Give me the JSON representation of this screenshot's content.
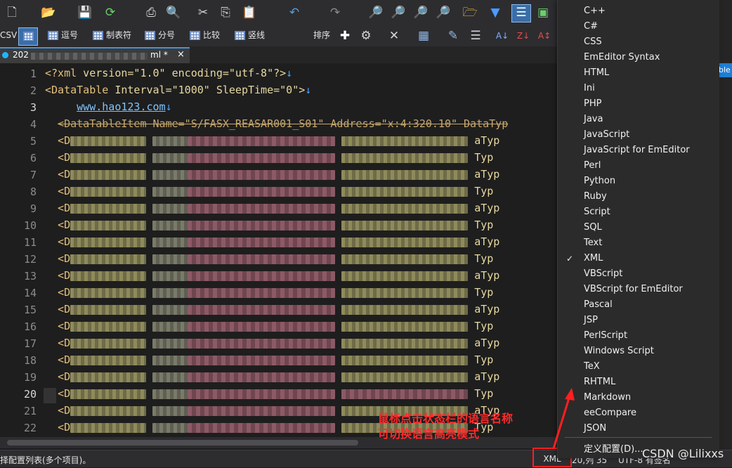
{
  "toolbar2": {
    "csv_label": "CSV",
    "buttons": [
      "逗号",
      "制表符",
      "分号",
      "比较",
      "竖线"
    ],
    "sort_label": "排序"
  },
  "tab": {
    "prefix": "202",
    "suffix": "ml *",
    "close": "×"
  },
  "gutter": {
    "lines": [
      "1",
      "2",
      "3",
      "4",
      "5",
      "6",
      "7",
      "8",
      "9",
      "10",
      "11",
      "12",
      "13",
      "14",
      "15",
      "16",
      "17",
      "18",
      "19",
      "20",
      "21",
      "22"
    ]
  },
  "editor": {
    "line1": {
      "open": "<?xml",
      "attrs": " version=\"1.0\" encoding=\"utf-8\"?>"
    },
    "line2": {
      "open": "<DataTable",
      "attrs": " Interval=\"1000\" SleepTime=\"0\">"
    },
    "line3": {
      "url": "www.hao123.com"
    },
    "line4": {
      "text": "<DataTableItem Name=\"S/FASX_REASAR001_S01\" Address=\"x:4:320.10\" DataTyp"
    },
    "row_start": "<D",
    "row_end_a": "aTyp",
    "row_end_b": "Typ",
    "eol": "↓"
  },
  "menu": {
    "items": [
      "C++",
      "C#",
      "CSS",
      "EmEditor Syntax",
      "HTML",
      "Ini",
      "PHP",
      "Java",
      "JavaScript",
      "JavaScript for EmEditor",
      "Perl",
      "Python",
      "Ruby",
      "Script",
      "SQL",
      "Text",
      "XML",
      "VBScript",
      "VBScript for EmEditor",
      "Pascal",
      "JSP",
      "PerlScript",
      "Windows Script",
      "TeX",
      "RHTML",
      "Markdown",
      "eeCompare",
      "JSON"
    ],
    "checked": "XML",
    "check_mark": "✓",
    "define_config": "定义配置(D)..."
  },
  "statusbar": {
    "left": "择配置列表(多个项目)。",
    "lang": "XML",
    "pos": "20,列 35",
    "encoding": "UTF-8 有签名"
  },
  "annotation": {
    "line1": "鼠标点击状态栏的语言名称",
    "line2": "可切换语言高亮模式"
  },
  "watermark": "CSDN @Lilixxs",
  "right_strip_label": "ble",
  "colors": {
    "accent": "#4a8fd8",
    "annotation": "#ff2a2a",
    "highlight_box": "#ff1f1f"
  }
}
